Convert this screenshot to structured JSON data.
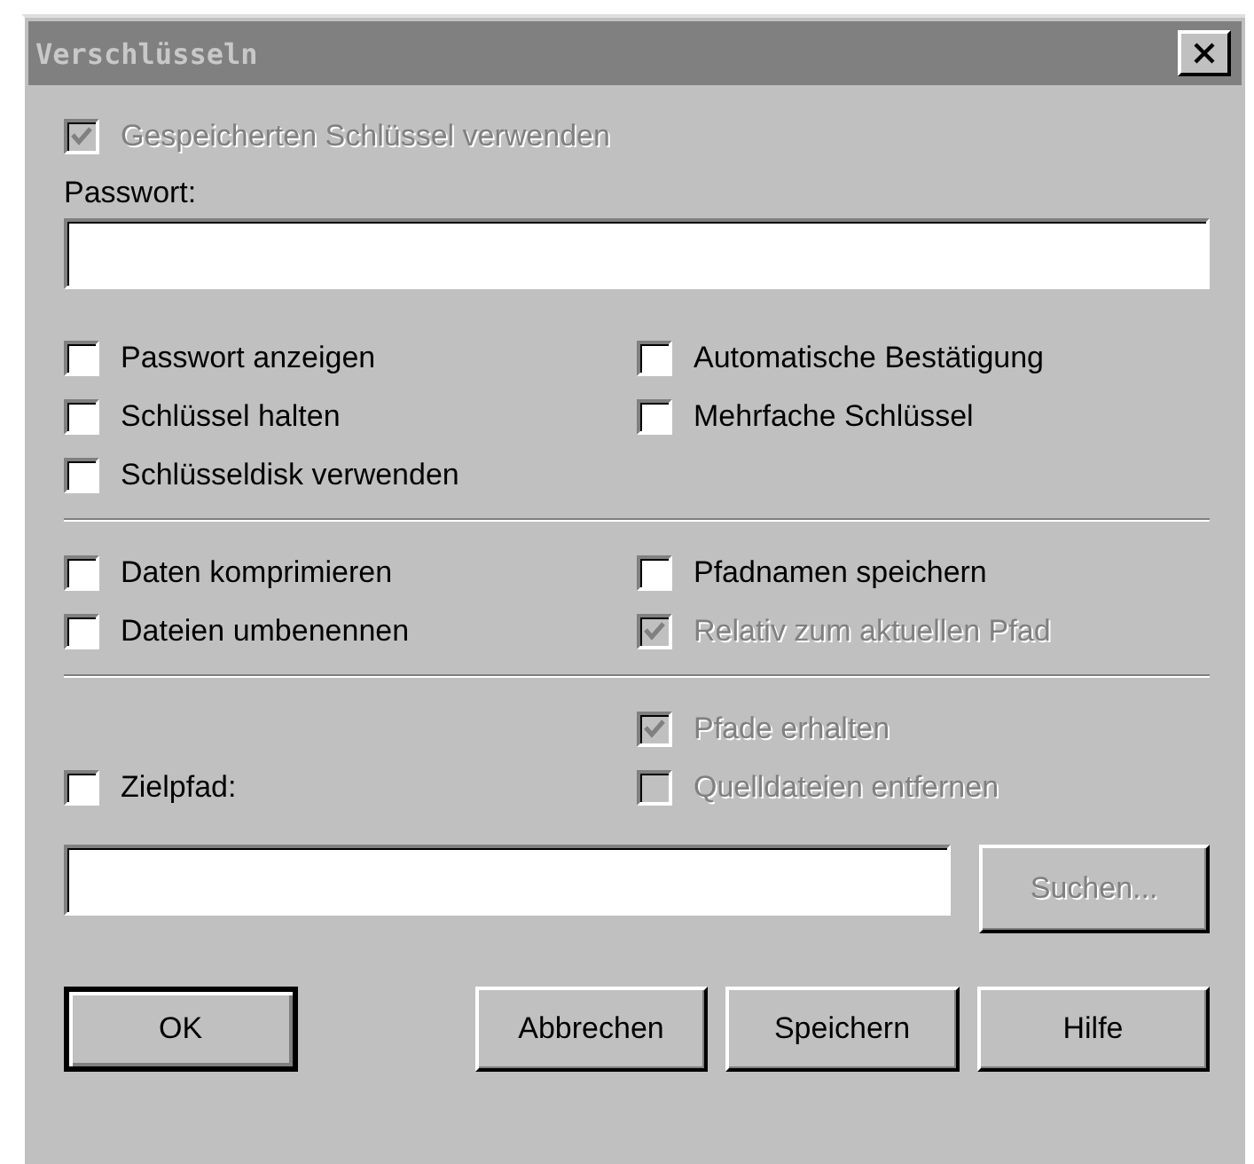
{
  "window": {
    "title": "Verschlüsseln"
  },
  "use_stored_key": {
    "label": "Gespeicherten Schlüssel verwenden",
    "checked": true,
    "disabled": true
  },
  "password": {
    "label": "Passwort:"
  },
  "key_options": [
    {
      "label": "Passwort anzeigen",
      "checked": false,
      "disabled": false
    },
    {
      "label": "Automatische Bestätigung",
      "checked": false,
      "disabled": false
    },
    {
      "label": "Schlüssel halten",
      "checked": false,
      "disabled": false
    },
    {
      "label": "Mehrfache Schlüssel",
      "checked": false,
      "disabled": false
    },
    {
      "label": "Schlüsseldisk verwenden",
      "checked": false,
      "disabled": false
    }
  ],
  "file_options": [
    {
      "label": "Daten komprimieren",
      "checked": false,
      "disabled": false
    },
    {
      "label": "Pfadnamen speichern",
      "checked": false,
      "disabled": false
    },
    {
      "label": "Dateien umbenennen",
      "checked": false,
      "disabled": false
    },
    {
      "label": "Relativ zum aktuellen Pfad",
      "checked": true,
      "disabled": true
    }
  ],
  "path_options": [
    {
      "label": "Pfade erhalten",
      "checked": true,
      "disabled": true
    },
    {
      "label": "Quelldateien entfernen",
      "checked": false,
      "disabled": true
    }
  ],
  "target_path": {
    "label": "Zielpfad:",
    "checked": false,
    "disabled": false
  },
  "browse_button": {
    "label": "Suchen...",
    "disabled": true
  },
  "buttons": [
    {
      "label": "OK",
      "default": true
    },
    {
      "label": "Abbrechen",
      "default": false
    },
    {
      "label": "Speichern",
      "default": false
    },
    {
      "label": "Hilfe",
      "default": false
    }
  ]
}
